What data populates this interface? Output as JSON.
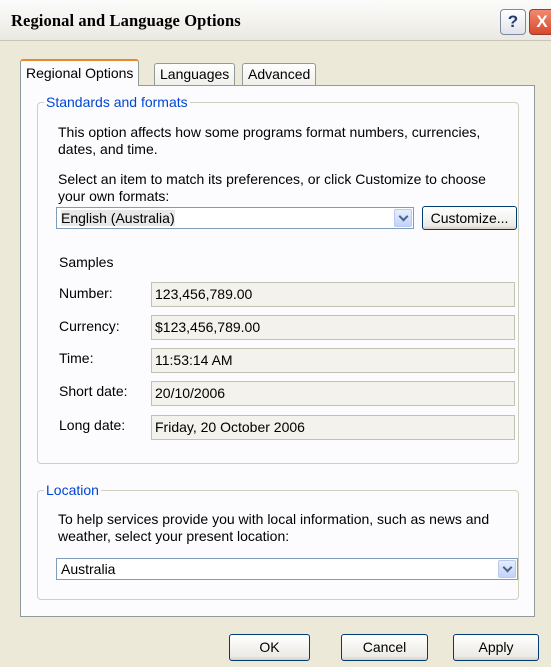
{
  "window": {
    "title": "Regional and Language Options",
    "help_glyph": "?",
    "close_glyph": "X"
  },
  "tabs": [
    "Regional Options",
    "Languages",
    "Advanced"
  ],
  "standards": {
    "legend": "Standards and formats",
    "description_line1": "This option affects how some programs format numbers, currencies,",
    "description_line2": "dates, and time.",
    "select_line1": "Select an item to match its preferences, or click Customize to choose",
    "select_line2": "your own formats:",
    "format_value": "English (Australia)",
    "customize_label": "Customize...",
    "samples_label": "Samples",
    "samples": [
      {
        "label": "Number:",
        "value": "123,456,789.00"
      },
      {
        "label": "Currency:",
        "value": "$123,456,789.00"
      },
      {
        "label": "Time:",
        "value": "11:53:14 AM"
      },
      {
        "label": "Short date:",
        "value": "20/10/2006"
      },
      {
        "label": "Long date:",
        "value": "Friday, 20 October 2006"
      }
    ]
  },
  "location": {
    "legend": "Location",
    "description_line1": "To help services provide you with local information, such as news and",
    "description_line2": "weather, select your present location:",
    "value": "Australia"
  },
  "buttons": {
    "ok": "OK",
    "cancel": "Cancel",
    "apply": "Apply"
  }
}
